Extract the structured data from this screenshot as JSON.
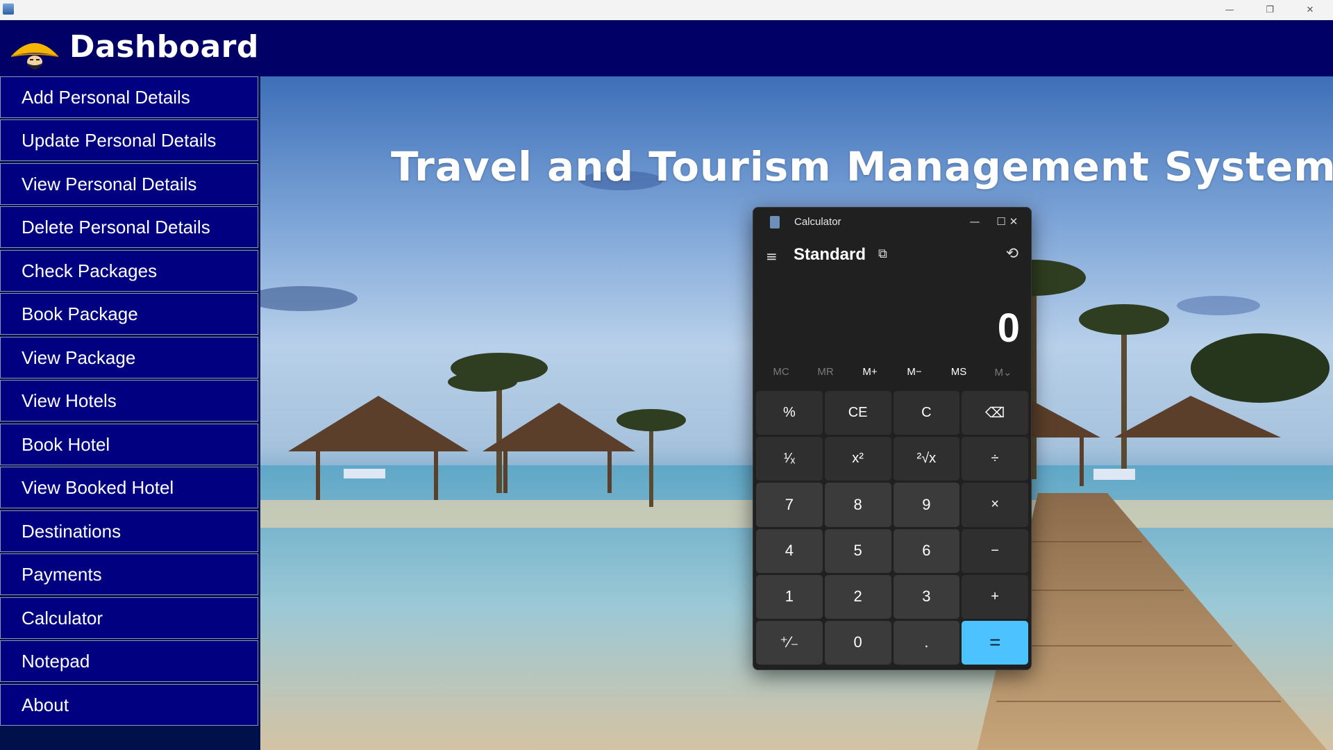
{
  "os_window": {
    "minimize_glyph": "—",
    "restore_glyph": "❐",
    "close_glyph": "✕"
  },
  "header": {
    "title": "Dashboard"
  },
  "sidebar": {
    "items": [
      {
        "label": "Add Personal Details"
      },
      {
        "label": "Update Personal Details"
      },
      {
        "label": "View Personal Details"
      },
      {
        "label": "Delete Personal Details"
      },
      {
        "label": "Check Packages"
      },
      {
        "label": "Book Package"
      },
      {
        "label": "View Package"
      },
      {
        "label": "View Hotels"
      },
      {
        "label": "Book Hotel"
      },
      {
        "label": "View Booked Hotel"
      },
      {
        "label": "Destinations"
      },
      {
        "label": "Payments"
      },
      {
        "label": "Calculator"
      },
      {
        "label": "Notepad"
      },
      {
        "label": "About"
      }
    ]
  },
  "main": {
    "title": "Travel and Tourism Management System"
  },
  "calculator": {
    "window_title": "Calculator",
    "mode": "Standard",
    "display": "0",
    "memory": [
      {
        "label": "MC",
        "enabled": false
      },
      {
        "label": "MR",
        "enabled": false
      },
      {
        "label": "M+",
        "enabled": true
      },
      {
        "label": "M−",
        "enabled": true
      },
      {
        "label": "MS",
        "enabled": true
      },
      {
        "label": "M⌄",
        "enabled": false
      }
    ],
    "keys": [
      {
        "label": "%",
        "kind": "op"
      },
      {
        "label": "CE",
        "kind": "op"
      },
      {
        "label": "C",
        "kind": "op"
      },
      {
        "label": "⌫",
        "kind": "op"
      },
      {
        "label": "¹⁄ₓ",
        "kind": "op"
      },
      {
        "label": "x²",
        "kind": "op"
      },
      {
        "label": "²√x",
        "kind": "op"
      },
      {
        "label": "÷",
        "kind": "op"
      },
      {
        "label": "7",
        "kind": "num"
      },
      {
        "label": "8",
        "kind": "num"
      },
      {
        "label": "9",
        "kind": "num"
      },
      {
        "label": "×",
        "kind": "op"
      },
      {
        "label": "4",
        "kind": "num"
      },
      {
        "label": "5",
        "kind": "num"
      },
      {
        "label": "6",
        "kind": "num"
      },
      {
        "label": "−",
        "kind": "op"
      },
      {
        "label": "1",
        "kind": "num"
      },
      {
        "label": "2",
        "kind": "num"
      },
      {
        "label": "3",
        "kind": "num"
      },
      {
        "label": "+",
        "kind": "op"
      },
      {
        "label": "⁺⁄₋",
        "kind": "num"
      },
      {
        "label": "0",
        "kind": "num"
      },
      {
        "label": ".",
        "kind": "num"
      },
      {
        "label": "=",
        "kind": "eq"
      }
    ],
    "accent_color": "#4cc2ff"
  },
  "colors": {
    "header_bg": "#000066",
    "menu_bg": "#000080",
    "calc_bg": "#202020"
  }
}
